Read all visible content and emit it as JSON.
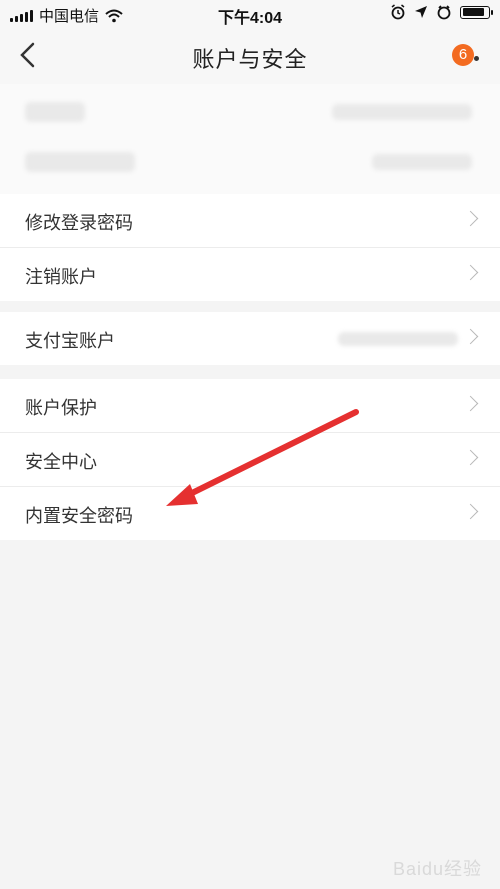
{
  "status_bar": {
    "carrier": "中国电信",
    "time": "下午4:04"
  },
  "nav": {
    "title": "账户与安全",
    "badge_count": "6"
  },
  "sections": {
    "group1_rows": [
      "修改登录密码",
      "注销账户"
    ],
    "group2_rows": [
      "支付宝账户"
    ],
    "group3_rows": [
      "账户保护",
      "安全中心",
      "内置安全密码"
    ]
  },
  "watermark": {
    "text": "Baidu经验"
  },
  "colors": {
    "badge": "#f36b21",
    "arrow": "#e53030"
  },
  "icons": [
    "signal-icon",
    "wifi-icon",
    "alarm-icon",
    "location-icon",
    "battery-icon",
    "back-icon",
    "more-icon",
    "chevron-right-icon"
  ]
}
